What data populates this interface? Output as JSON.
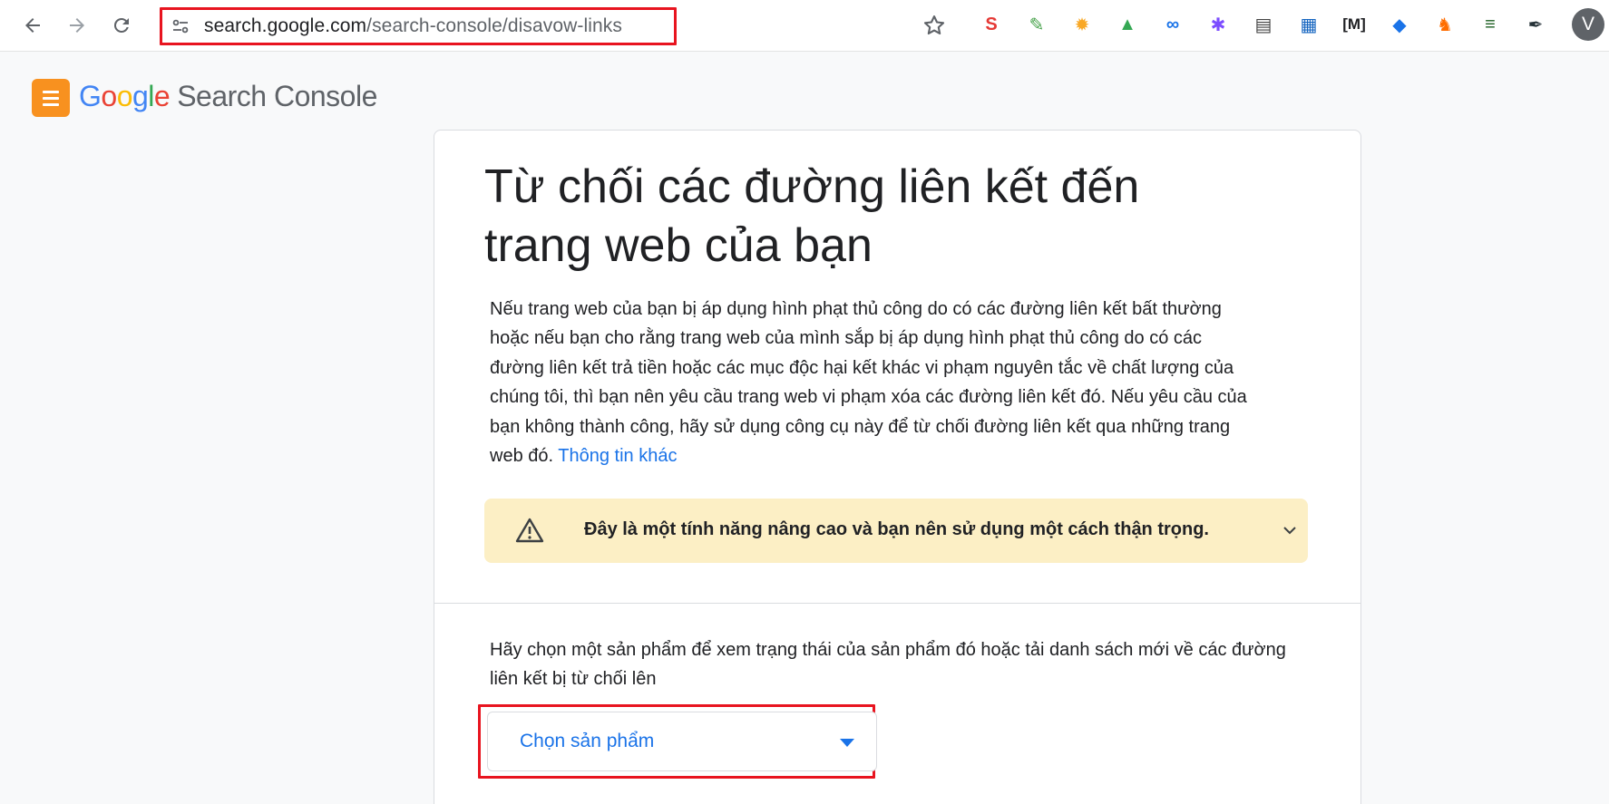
{
  "browser": {
    "url_host": "search.google.com",
    "url_path": "/search-console/disavow-links",
    "avatar_letter": "V",
    "extensions": [
      {
        "name": "s-extension-icon",
        "glyph": "S",
        "color": "#e53935"
      },
      {
        "name": "leaf-extension-icon",
        "glyph": "✎",
        "color": "#43a047"
      },
      {
        "name": "sun-extension-icon",
        "glyph": "✹",
        "color": "#f9a825"
      },
      {
        "name": "drive-extension-icon",
        "glyph": "▲",
        "color": "#34a853"
      },
      {
        "name": "link-extension-icon",
        "glyph": "∞",
        "color": "#1a73e8"
      },
      {
        "name": "gear-extension-icon",
        "glyph": "✱",
        "color": "#7c4dff"
      },
      {
        "name": "clipboard-extension-icon",
        "glyph": "▤",
        "color": "#424242"
      },
      {
        "name": "calendar-extension-icon",
        "glyph": "▦",
        "color": "#1565c0"
      },
      {
        "name": "m-extension-icon",
        "glyph": "[M]",
        "color": "#202124"
      },
      {
        "name": "tag-extension-icon",
        "glyph": "◆",
        "color": "#1a73e8"
      },
      {
        "name": "fox-extension-icon",
        "glyph": "♞",
        "color": "#ff6d00"
      },
      {
        "name": "sheet-extension-icon",
        "glyph": "≡",
        "color": "#1b5e20"
      },
      {
        "name": "eyedropper-extension-icon",
        "glyph": "✒",
        "color": "#263238"
      }
    ]
  },
  "header": {
    "logo_letters": [
      "G",
      "o",
      "o",
      "g",
      "l",
      "e"
    ],
    "product_name": "Search Console"
  },
  "main": {
    "title": "Từ chối các đường liên kết đến trang web của bạn",
    "description": "Nếu trang web của bạn bị áp dụng hình phạt thủ công do có các đường liên kết bất thường hoặc nếu bạn cho rằng trang web của mình sắp bị áp dụng hình phạt thủ công do có các đường liên kết trả tiền hoặc các mục độc hại kết khác vi phạm nguyên tắc về chất lượng của chúng tôi, thì bạn nên yêu cầu trang web vi phạm xóa các đường liên kết đó. Nếu yêu cầu của bạn không thành công, hãy sử dụng công cụ này để từ chối đường liên kết qua những trang web đó.",
    "learn_more": "Thông tin khác",
    "warning_text": "Đây là một tính năng nâng cao và bạn nên sử dụng một cách thận trọng.",
    "choose_prompt": "Hãy chọn một sản phẩm để xem trạng thái của sản phẩm đó hoặc tải danh sách mới về các đường liên kết bị từ chối lên",
    "select_label": "Chọn sản phẩm"
  }
}
